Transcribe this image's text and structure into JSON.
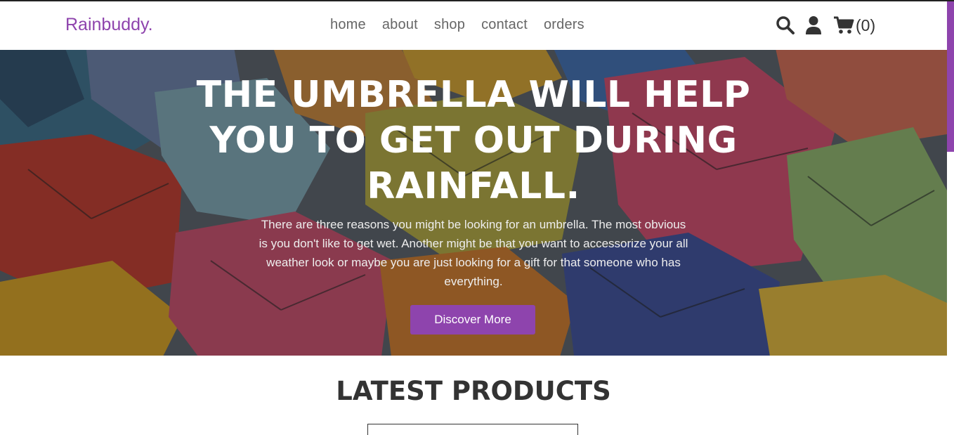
{
  "brand": {
    "name": "Rainbuddy.",
    "color": "#8e44ad"
  },
  "nav": {
    "items": [
      {
        "label": "home"
      },
      {
        "label": "about"
      },
      {
        "label": "shop"
      },
      {
        "label": "contact"
      },
      {
        "label": "orders"
      }
    ]
  },
  "header_icons": {
    "search": "search-icon",
    "user": "user-icon",
    "cart": "cart-icon",
    "cart_count": "(0)"
  },
  "hero": {
    "title": "THE UMBRELLA WILL HELP YOU TO GET OUT DURING RAINFALL.",
    "text": "There are three reasons you might be looking for an umbrella. The most obvious is you don't like to get wet. Another might be that you want to accessorize your all weather look or maybe you are just looking for a gift for that someone who has everything.",
    "button_label": "Discover More",
    "background": "colorful-umbrellas-photo"
  },
  "latest_products": {
    "title": "LATEST PRODUCTS"
  },
  "colors": {
    "accent": "#8e44ad",
    "text": "#333333"
  }
}
